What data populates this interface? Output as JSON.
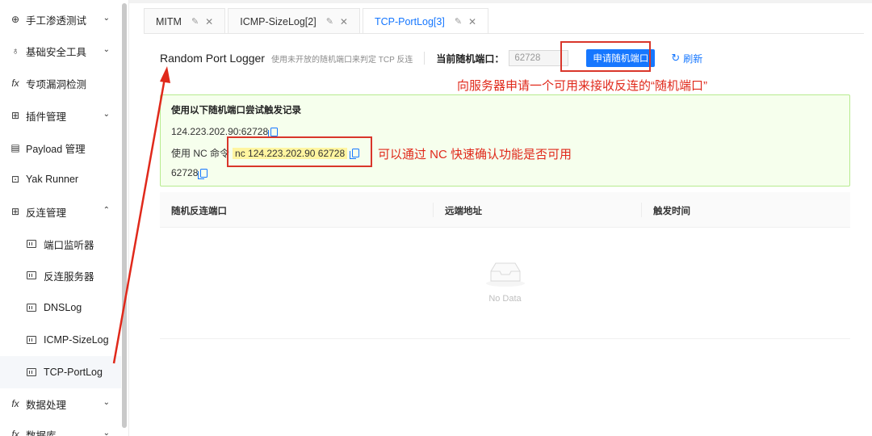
{
  "sidebar": {
    "items": [
      {
        "icon": "target-icon",
        "glyph": "⊕",
        "label": "手工渗透测试",
        "chevron": "⌄"
      },
      {
        "icon": "tools-icon",
        "glyph": "♁",
        "label": "基础安全工具",
        "chevron": "⌄"
      },
      {
        "icon": "function-icon",
        "glyph": "fx",
        "label": "专项漏洞检测",
        "chevron": ""
      },
      {
        "icon": "plugin-icon",
        "glyph": "⊞",
        "label": "插件管理",
        "chevron": "⌄"
      },
      {
        "icon": "payload-icon",
        "glyph": "▤",
        "label": "Payload 管理",
        "chevron": ""
      },
      {
        "icon": "terminal-icon",
        "glyph": "⊡",
        "label": "Yak Runner",
        "chevron": ""
      },
      {
        "icon": "reverse-icon",
        "glyph": "⊞",
        "label": "反连管理",
        "chevron": "⌃"
      }
    ],
    "subitems": [
      "端口监听器",
      "反连服务器",
      "DNSLog",
      "ICMP-SizeLog",
      "TCP-PortLog"
    ],
    "bottom_items": [
      {
        "icon": "function-icon",
        "glyph": "fx",
        "label": "数据处理",
        "chevron": "⌄"
      },
      {
        "icon": "database-icon",
        "glyph": "fx",
        "label": "数据库",
        "chevron": "⌄"
      }
    ]
  },
  "tabs": [
    {
      "label": "MITM"
    },
    {
      "label": "ICMP-SizeLog[2]"
    },
    {
      "label": "TCP-PortLog[3]"
    }
  ],
  "tab_edit_glyph": "✎",
  "tab_close_glyph": "✕",
  "header": {
    "title": "Random Port Logger",
    "subtitle": "使用未开放的随机端口来判定 TCP 反连",
    "port_label": "当前随机端口：",
    "port_value": "62728",
    "request_button": "申请随机端口",
    "refresh_label": "刷新",
    "refresh_glyph": "↻"
  },
  "annotations": {
    "button_note": "向服务器申请一个可用来接收反连的“随机端口”",
    "nc_note": "可以通过 NC 快速确认功能是否可用"
  },
  "notice": {
    "title": "使用以下随机端口尝试触发记录",
    "address": "124.223.202.90:62728",
    "nc_prefix": "使用 NC 命令",
    "nc_command": "nc 124.223.202.90 62728",
    "port": "62728"
  },
  "table": {
    "columns": [
      "随机反连端口",
      "远端地址",
      "触发时间"
    ],
    "empty_text": "No Data"
  },
  "colors": {
    "accent": "#1677ff",
    "annotation": "#e0291b",
    "notice_bg": "#f6ffed"
  }
}
